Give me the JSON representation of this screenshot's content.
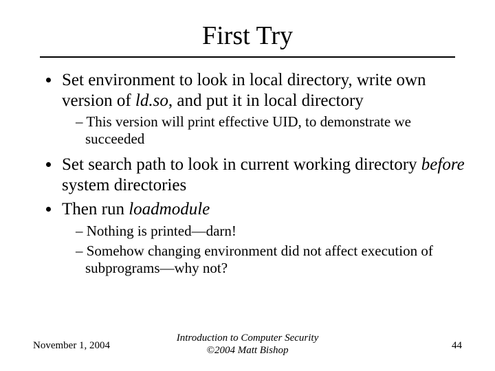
{
  "title": "First Try",
  "bullets": {
    "b1_pre": "Set environment to look in local directory, write own version of  ",
    "b1_em": "ld.so",
    "b1_post": ", and put it in local directory",
    "b1_sub1": "This version will print effective UID, to demonstrate we succeeded",
    "b2_pre": "Set search path to look in current working directory ",
    "b2_em": "before",
    "b2_post": " system directories",
    "b3_pre": "Then run ",
    "b3_em": "loadmodule",
    "b3_sub1": "Nothing is printed—darn!",
    "b3_sub2": "Somehow changing environment did not affect execution of subprograms—why not?"
  },
  "footer": {
    "date": "November 1, 2004",
    "center_line1": "Introduction to Computer Security",
    "center_line2": "©2004 Matt Bishop",
    "page": "44"
  }
}
